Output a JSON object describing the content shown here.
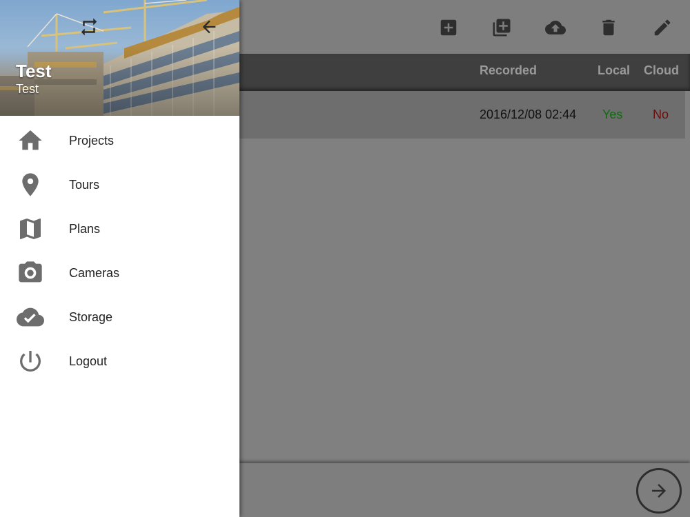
{
  "toolbar": {
    "buttons": [
      {
        "name": "add-button",
        "icon": "plus-box-icon"
      },
      {
        "name": "add-multiple-button",
        "icon": "library-add-icon"
      },
      {
        "name": "upload-button",
        "icon": "cloud-upload-icon"
      },
      {
        "name": "delete-button",
        "icon": "trash-icon"
      },
      {
        "name": "edit-button",
        "icon": "pencil-icon"
      }
    ]
  },
  "table": {
    "columns": [
      "Recorded",
      "Local",
      "Cloud"
    ],
    "rows": [
      {
        "recorded": "2016/12/08 02:44",
        "local": "Yes",
        "cloud": "No"
      }
    ]
  },
  "fab": {
    "icon": "arrow-right-icon"
  },
  "drawer": {
    "user": {
      "name": "Test",
      "subtitle": "Test"
    },
    "header_icons": {
      "switch": "swap-icon",
      "back": "arrow-left-icon"
    },
    "items": [
      {
        "label": "Projects",
        "icon": "home-icon"
      },
      {
        "label": "Tours",
        "icon": "map-marker-icon"
      },
      {
        "label": "Plans",
        "icon": "map-icon"
      },
      {
        "label": "Cameras",
        "icon": "camera-icon"
      },
      {
        "label": "Storage",
        "icon": "cloud-check-icon"
      },
      {
        "label": "Logout",
        "icon": "power-icon"
      }
    ]
  },
  "colors": {
    "local_yes": "#0e6b0e",
    "cloud_no": "#6b0d0d",
    "drawer_bg": "#ffffff",
    "scrim": "#808080"
  }
}
